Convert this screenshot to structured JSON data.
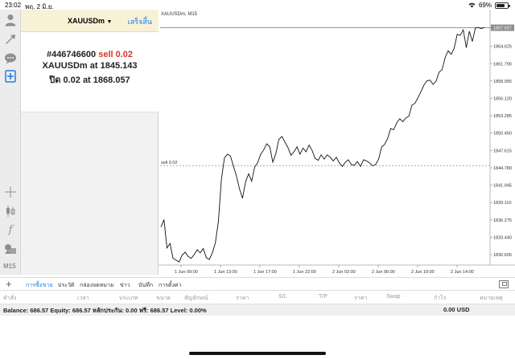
{
  "status_bar": {
    "time": "23:02",
    "date": "พฤ. 2 มิ.ย.",
    "battery": "69%"
  },
  "order_panel": {
    "symbol": "XAUUSDm",
    "done_label": "เสร็จสิ้น",
    "ticket": "#446746600",
    "action": "sell 0.02",
    "line2_prefix": "XAUUSDm at",
    "line2_value": "1845.143",
    "line3_prefix": "ปิด 0.02 at",
    "line3_value": "1868.057"
  },
  "toolbar": {
    "timeframe": "M15"
  },
  "chart_data": {
    "type": "line",
    "title": "XAUUSDm, M15",
    "current_price": "1867.657",
    "order_line": {
      "label": "sell 0.02",
      "value": 1845.143
    },
    "yticks": [
      "1867.657",
      "1864.625",
      "1861.790",
      "1858.955",
      "1856.120",
      "1853.285",
      "1850.450",
      "1847.615",
      "1844.780",
      "1841.945",
      "1839.110",
      "1836.275",
      "1833.440",
      "1830.605"
    ],
    "xticks": [
      "1 Jun 09:00",
      "1 Jun 13:00",
      "1 Jun 17:00",
      "1 Jun 22:00",
      "2 Jun 02:00",
      "2 Jun 06:00",
      "2 Jun 10:00",
      "2 Jun 14:00"
    ],
    "ylim": [
      1828.9,
      1869.3
    ],
    "y": [
      1835.1,
      1836.3,
      1831.7,
      1832.4,
      1830.0,
      1829.7,
      1829.4,
      1830.5,
      1831.0,
      1830.3,
      1830.0,
      1830.6,
      1831.4,
      1830.9,
      1831.6,
      1830.1,
      1829.8,
      1830.9,
      1832.5,
      1836.0,
      1842.8,
      1846.4,
      1847.0,
      1846.7,
      1845.0,
      1843.4,
      1841.3,
      1839.8,
      1842.5,
      1843.8,
      1842.6,
      1844.9,
      1845.6,
      1847.0,
      1847.7,
      1848.7,
      1848.2,
      1845.7,
      1847.1,
      1849.4,
      1849.9,
      1849.0,
      1848.1,
      1846.8,
      1847.4,
      1848.2,
      1847.0,
      1848.0,
      1847.4,
      1848.5,
      1847.6,
      1846.3,
      1846.0,
      1846.9,
      1846.2,
      1846.9,
      1846.5,
      1845.9,
      1846.5,
      1845.6,
      1845.0,
      1845.7,
      1846.1,
      1845.3,
      1845.2,
      1845.8,
      1845.0,
      1846.1,
      1845.9,
      1845.6,
      1845.1,
      1845.3,
      1846.2,
      1848.2,
      1848.6,
      1849.6,
      1851.2,
      1851.0,
      1852.1,
      1852.8,
      1852.3,
      1852.9,
      1853.2,
      1855.0,
      1855.3,
      1856.2,
      1857.2,
      1858.3,
      1859.0,
      1859.1,
      1858.4,
      1858.9,
      1860.4,
      1860.8,
      1862.8,
      1863.9,
      1863.3,
      1864.3,
      1866.6,
      1866.4,
      1867.3,
      1864.4,
      1867.1,
      1865.4,
      1867.6,
      1867.7,
      1867.5,
      1867.7
    ]
  },
  "bottom_tabs": {
    "tabs": [
      "การซื้อขาย",
      "ประวัติ",
      "กล่องจดหมาย",
      "ข่าว",
      "บันทึก",
      "การตั้งค่า"
    ]
  },
  "table_headers": [
    "คำสั่ง",
    "เวลา",
    "ประเภท",
    "ขนาด",
    "สัญลักษณ์",
    "ราคา",
    "S/L",
    "T/P",
    "ราคา",
    "Swap",
    "กำไร",
    "หมายเหตุ"
  ],
  "balance": {
    "text": "Balance: 686.57 Equity: 686.57 หลักประกัน: 0.00 ฟรี: 686.57 Level: 0.00%",
    "amount": "0.00  USD"
  }
}
